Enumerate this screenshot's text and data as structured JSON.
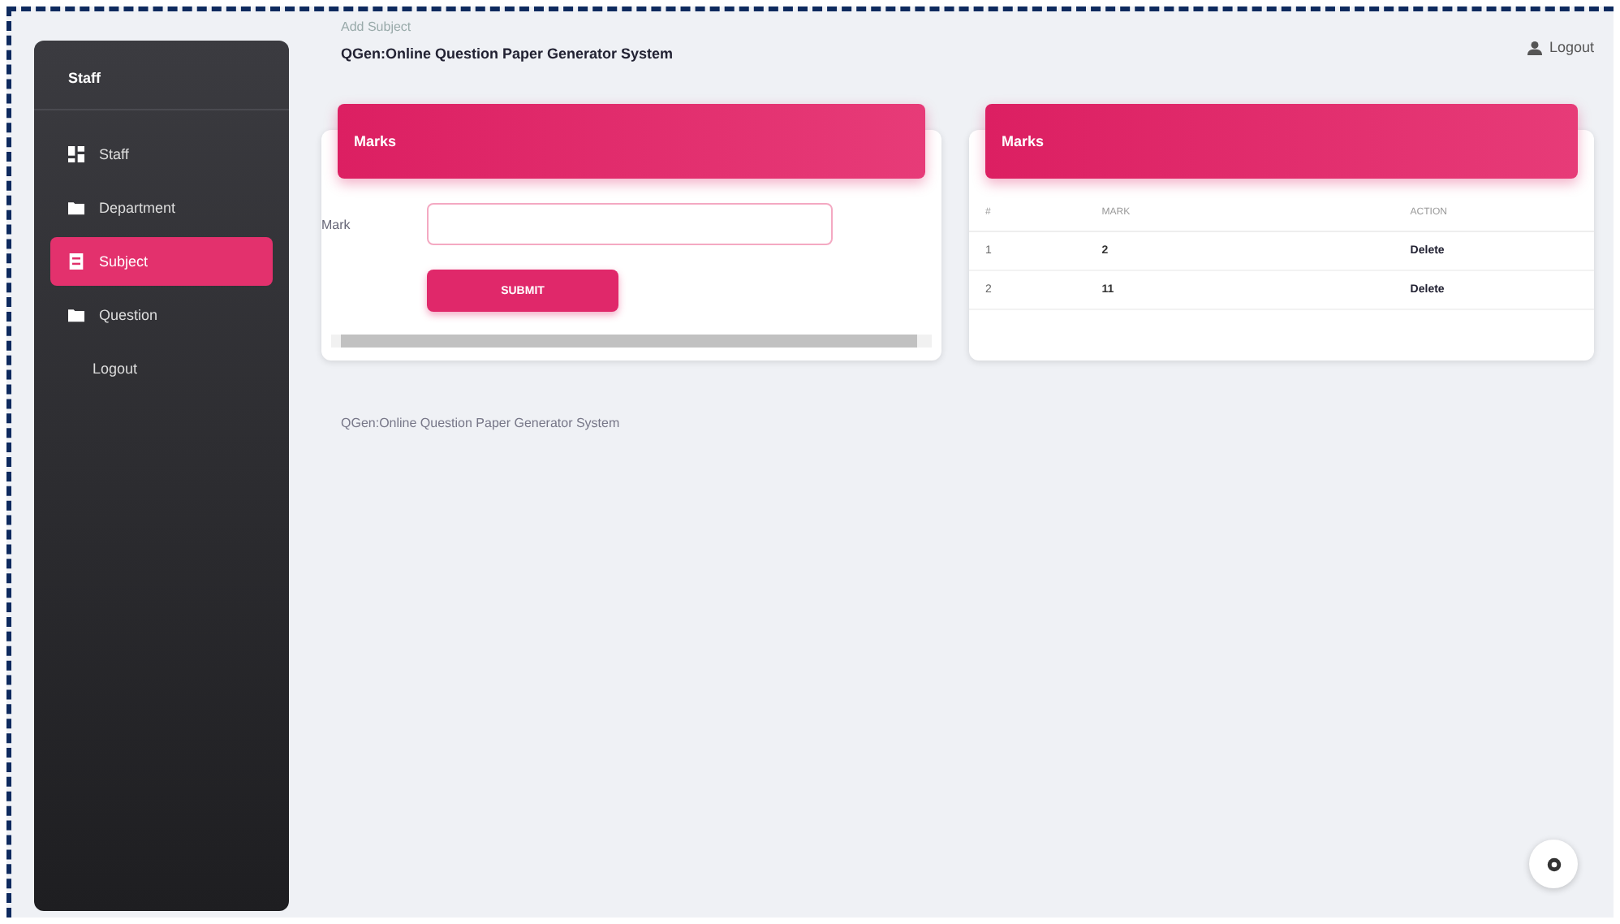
{
  "sidebar": {
    "brand": "Staff",
    "items": [
      {
        "label": "Staff",
        "selected": false
      },
      {
        "label": "Department",
        "selected": false
      },
      {
        "label": "Subject",
        "selected": true
      },
      {
        "label": "Question",
        "selected": false
      },
      {
        "label": "Logout",
        "selected": false
      }
    ]
  },
  "header": {
    "breadcrumb": "Add Subject",
    "title": "QGen:Online Question Paper Generator System",
    "logout": "Logout"
  },
  "form_card": {
    "title": "Marks",
    "field_label": "Mark",
    "button": "SUBMIT"
  },
  "table_card": {
    "title": "Marks",
    "columns": [
      "#",
      "MARK",
      "ACTION"
    ],
    "rows": [
      {
        "index": "1",
        "mark": "2",
        "action": "Delete"
      },
      {
        "index": "2",
        "mark": "11",
        "action": "Delete"
      }
    ]
  },
  "footer": "QGen:Online Question Paper Generator System"
}
